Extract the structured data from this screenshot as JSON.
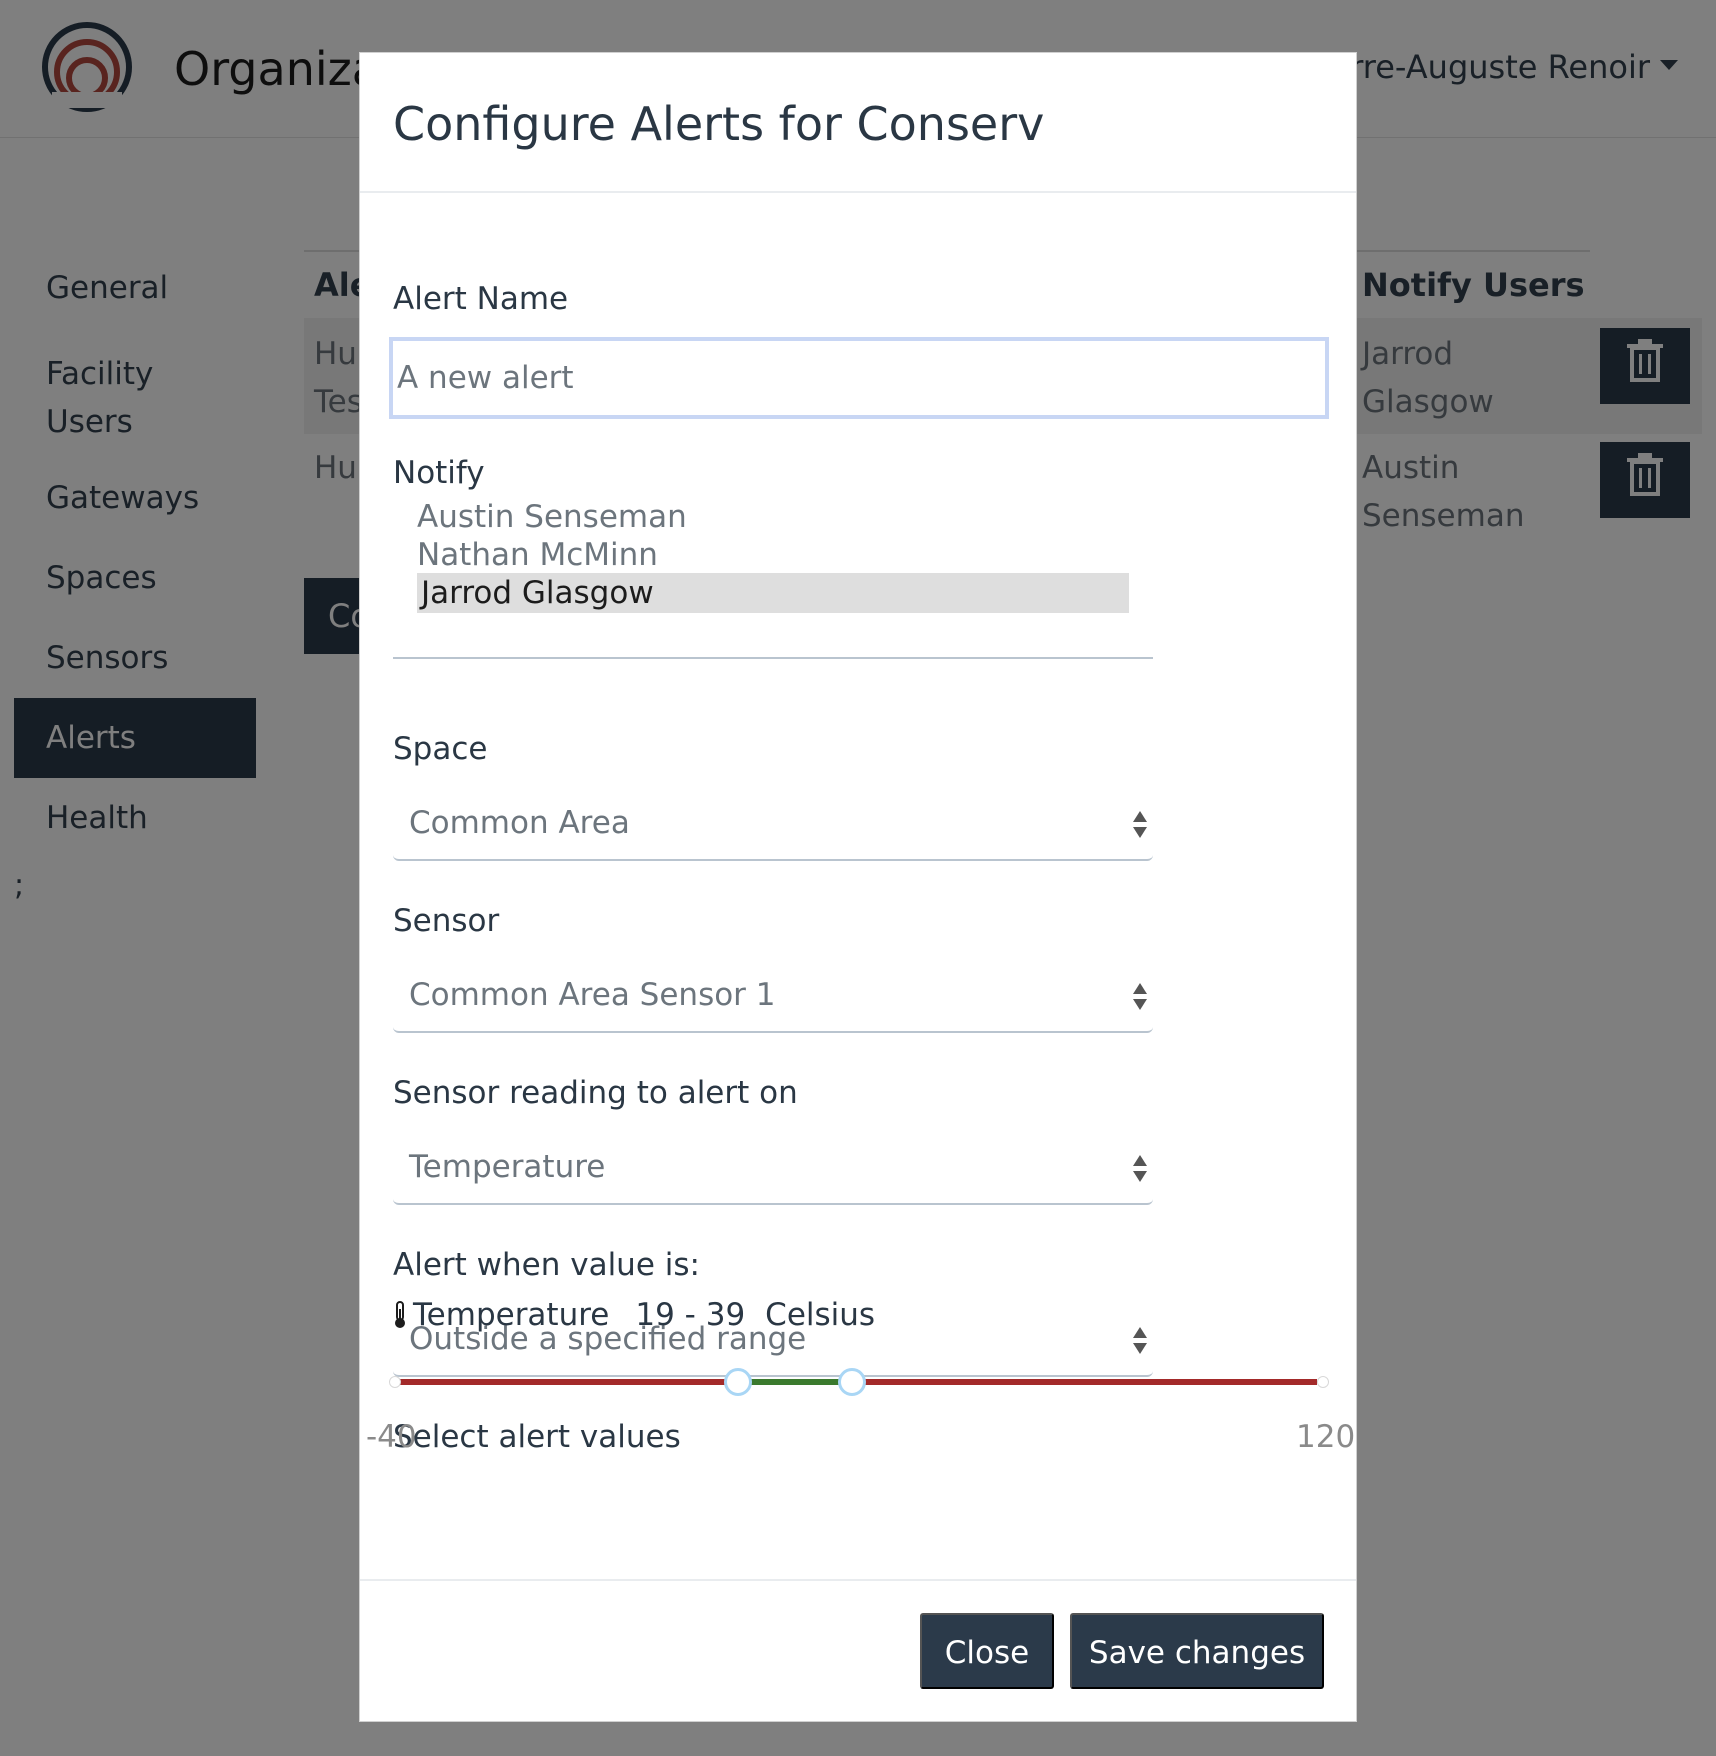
{
  "header": {
    "org_title": "Organiza",
    "user_name": "erre-Auguste Renoir"
  },
  "sidebar": {
    "items": [
      {
        "label": "General"
      },
      {
        "label": "Facility Users"
      },
      {
        "label": "Gateways"
      },
      {
        "label": "Spaces"
      },
      {
        "label": "Sensors"
      },
      {
        "label": "Alerts",
        "active": true
      },
      {
        "label": "Health"
      }
    ],
    "stray_text": ";"
  },
  "table": {
    "col_alert": "Ale",
    "col_notify_users": "Notify Users",
    "rows": [
      {
        "alert": "Hu\nTes",
        "notify": "Jarrod Glasgow"
      },
      {
        "alert": "Hu",
        "notify": "Austin Senseman"
      }
    ],
    "create_button": "Co"
  },
  "modal": {
    "title": "Configure Alerts for Conserv",
    "alert_name_label": "Alert Name",
    "alert_name_placeholder": "A new alert",
    "notify_label": "Notify",
    "notify_options": [
      "Austin Senseman",
      "Nathan McMinn",
      "Jarrod Glasgow"
    ],
    "notify_selected": "Jarrod Glasgow",
    "space_label": "Space",
    "space_value": "Common Area",
    "sensor_label": "Sensor",
    "sensor_value": "Common Area Sensor 1",
    "reading_label": "Sensor reading to alert on",
    "reading_value": "Temperature",
    "condition_label": "Alert when value is:",
    "condition_value": "Outside a specified range",
    "values_label": "Select alert values",
    "reading_name": "Temperature",
    "range_text": "19 - 39",
    "unit": "Celsius",
    "slider": {
      "min": -40,
      "max": 120,
      "low": 19,
      "high": 39,
      "min_label": "-40",
      "max_label": "120"
    },
    "close_label": "Close",
    "save_label": "Save changes"
  },
  "colors": {
    "primary_dark": "#2b3a4a",
    "range_out": "#a32a2a",
    "range_in": "#3b7a2e"
  }
}
